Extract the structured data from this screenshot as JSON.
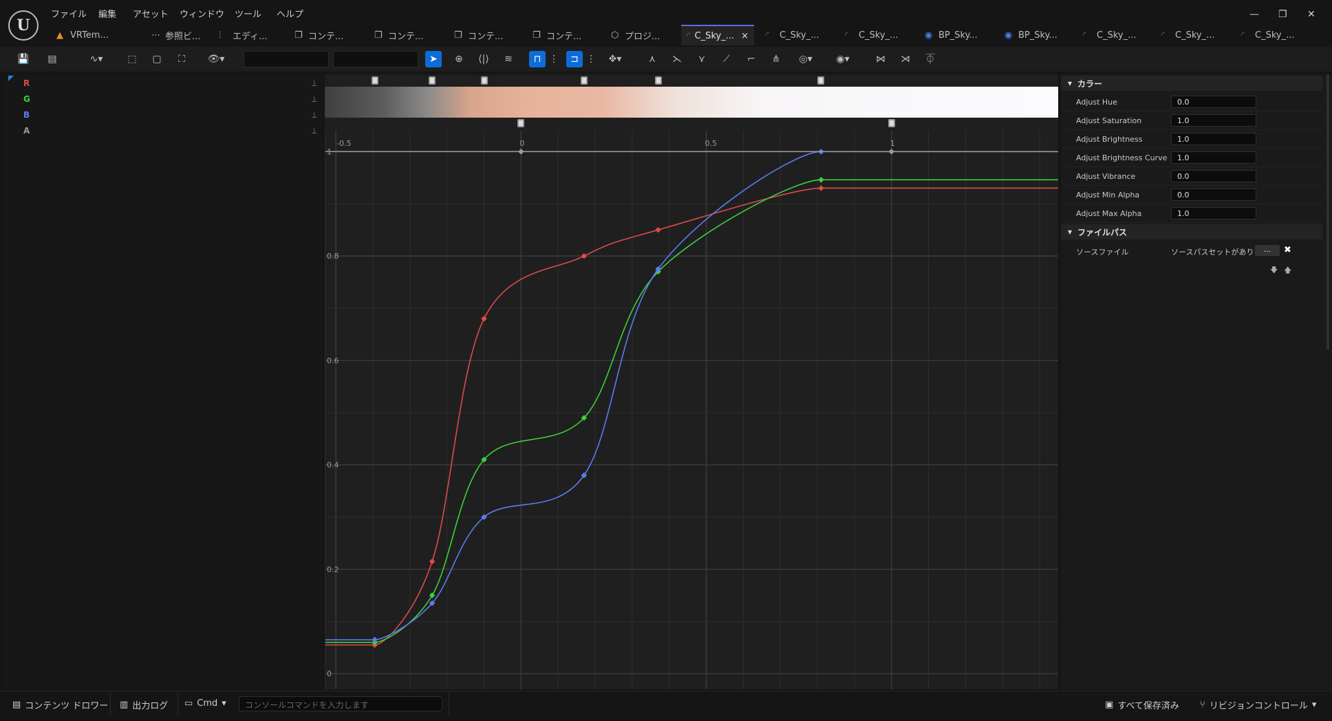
{
  "menu": [
    "ファイル",
    "編集",
    "アセット",
    "ウィンドウ",
    "ツール",
    "ヘルプ"
  ],
  "tabs": [
    {
      "label": "VRTem...",
      "icon": "warning-icon"
    },
    {
      "label": "参照ビ...",
      "icon": "graph-icon"
    },
    {
      "label": "エディ...",
      "icon": "sliders-icon"
    },
    {
      "label": "コンテ...",
      "icon": "folder-icon"
    },
    {
      "label": "コンテ...",
      "icon": "folder-icon"
    },
    {
      "label": "コンテ...",
      "icon": "folder-icon"
    },
    {
      "label": "コンテ...",
      "icon": "folder-icon"
    },
    {
      "label": "プロジ...",
      "icon": "cube-icon"
    },
    {
      "label": "C_Sky_...",
      "icon": "curve-icon",
      "active": true
    },
    {
      "label": "C_Sky_...",
      "icon": "curve-icon"
    },
    {
      "label": "C_Sky_...",
      "icon": "curve-icon"
    },
    {
      "label": "BP_Sky...",
      "icon": "blueprint-icon"
    },
    {
      "label": "BP_Sky...",
      "icon": "blueprint-icon"
    },
    {
      "label": "C_Sky_...",
      "icon": "curve-icon"
    },
    {
      "label": "C_Sky_...",
      "icon": "curve-icon"
    },
    {
      "label": "C_Sky_...",
      "icon": "curve-icon"
    }
  ],
  "channels": [
    {
      "label": "R",
      "color": "#e04a4a"
    },
    {
      "label": "G",
      "color": "#3dd13d"
    },
    {
      "label": "B",
      "color": "#5a7cf0"
    },
    {
      "label": "A",
      "color": "#9a9a9a"
    }
  ],
  "chart_data": {
    "type": "line",
    "x_ticks": [
      "-0.5",
      "0",
      "0.5",
      "1"
    ],
    "y_ticks": [
      "0",
      "0.2",
      "0.4",
      "0.6",
      "0.8",
      "1"
    ],
    "xlim": [
      -0.53,
      1.45
    ],
    "ylim": [
      -0.03,
      1.04
    ],
    "series": [
      {
        "name": "R",
        "color": "#e04a4a",
        "points": [
          [
            -0.395,
            0.055
          ],
          [
            -0.24,
            0.215
          ],
          [
            -0.1,
            0.68
          ],
          [
            0.17,
            0.8
          ],
          [
            0.37,
            0.85
          ],
          [
            0.81,
            0.93
          ]
        ]
      },
      {
        "name": "G",
        "color": "#3dd13d",
        "points": [
          [
            -0.395,
            0.06
          ],
          [
            -0.24,
            0.15
          ],
          [
            -0.1,
            0.41
          ],
          [
            0.17,
            0.49
          ],
          [
            0.37,
            0.77
          ],
          [
            0.81,
            0.946
          ]
        ]
      },
      {
        "name": "B",
        "color": "#5a7cf0",
        "points": [
          [
            -0.395,
            0.065
          ],
          [
            -0.24,
            0.135
          ],
          [
            -0.1,
            0.3
          ],
          [
            0.17,
            0.38
          ],
          [
            0.37,
            0.775
          ],
          [
            0.81,
            1.0
          ]
        ]
      },
      {
        "name": "A",
        "color": "#9a9a9a",
        "points": [
          [
            -0.53,
            1.0
          ],
          [
            0.0,
            1.0
          ],
          [
            1.0,
            1.0
          ],
          [
            1.45,
            1.0
          ]
        ]
      }
    ]
  },
  "gradient_stops_top": [
    -0.395,
    -0.24,
    -0.1,
    0.17,
    0.37,
    0.81
  ],
  "gradient_stops_bottom": [
    0.0,
    1.0
  ],
  "details": {
    "color_section": "カラー",
    "props": [
      {
        "label": "Adjust Hue",
        "value": "0.0"
      },
      {
        "label": "Adjust Saturation",
        "value": "1.0"
      },
      {
        "label": "Adjust Brightness",
        "value": "1.0"
      },
      {
        "label": "Adjust Brightness Curve",
        "value": "1.0"
      },
      {
        "label": "Adjust Vibrance",
        "value": "0.0"
      },
      {
        "label": "Adjust Min Alpha",
        "value": "0.0"
      },
      {
        "label": "Adjust Max Alpha",
        "value": "1.0"
      }
    ],
    "file_section": "ファイルパス",
    "source_label": "ソースファイル",
    "source_value": "ソースパスセットがありま",
    "browse_label": "..."
  },
  "statusbar": {
    "content_drawer": "コンテンツ ドロワー",
    "output_log": "出力ログ",
    "cmd": "Cmd",
    "console_placeholder": "コンソールコマンドを入力します",
    "save_all": "すべて保存済み",
    "revision": "リビジョンコントロール"
  }
}
